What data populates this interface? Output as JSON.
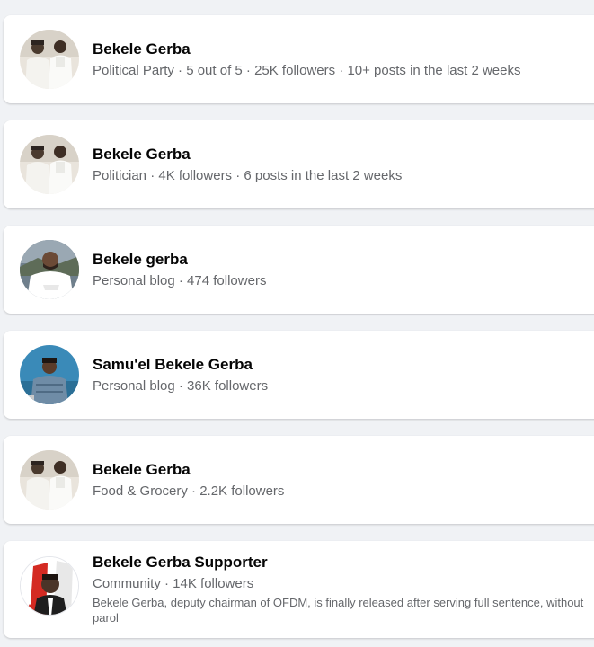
{
  "results": [
    {
      "name": "Bekele Gerba",
      "meta": "Political Party · 5 out of 5 · 25K followers · 10+ posts in the last 2 weeks",
      "avatar": "two-men-photo"
    },
    {
      "name": "Bekele Gerba",
      "meta": "Politician · 4K followers · 6 posts in the last 2 weeks",
      "avatar": "two-men-photo"
    },
    {
      "name": "Bekele gerba",
      "meta": "Personal blog · 474 followers",
      "avatar": "man-in-white-shirt-photo"
    },
    {
      "name": "Samu'el Bekele Gerba",
      "meta": "Personal blog · 36K followers",
      "avatar": "man-blue-background-photo"
    },
    {
      "name": "Bekele Gerba",
      "meta": "Food & Grocery · 2.2K followers",
      "avatar": "two-men-photo"
    },
    {
      "name": "Bekele Gerba Supporter",
      "meta": "Community · 14K followers",
      "description": "Bekele Gerba, deputy chairman of OFDM, is finally released after serving full sentence, without parol",
      "avatar": "red-poster-portrait"
    }
  ]
}
